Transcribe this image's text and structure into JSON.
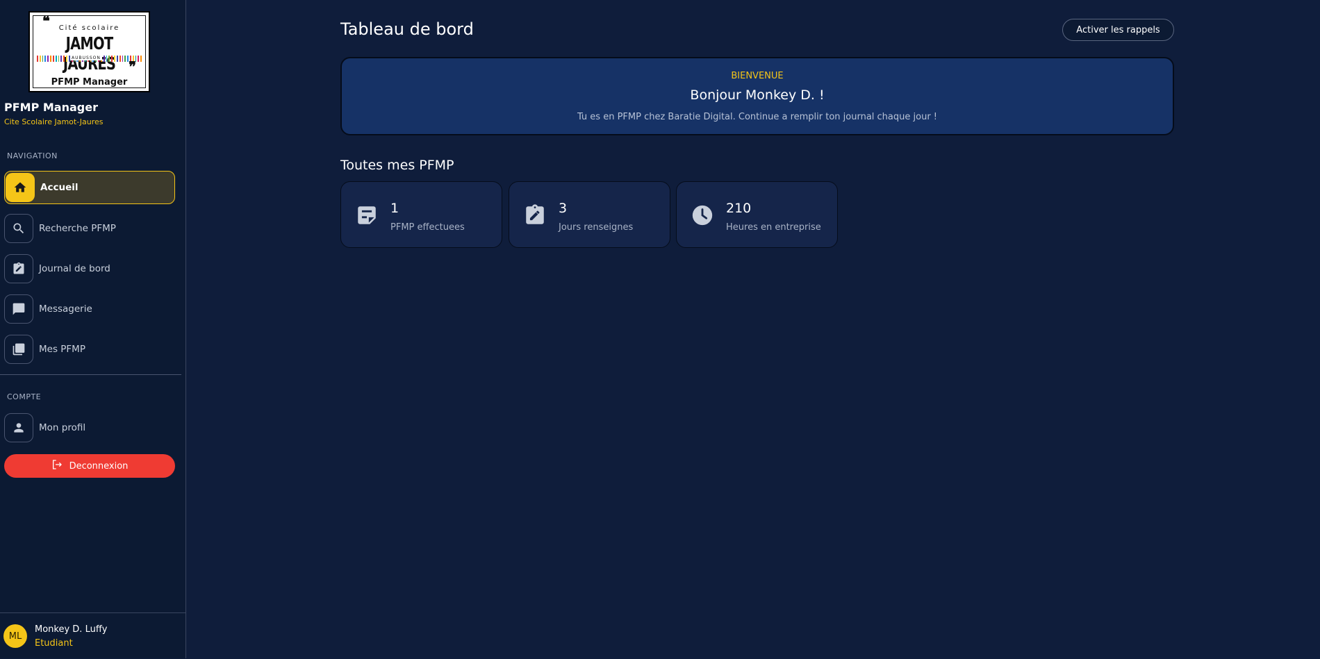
{
  "sidebar": {
    "logo": {
      "line1": "Cité scolaire",
      "line2": "JAMOT JAURES",
      "line3": "AUBUSSON",
      "line4": "PFMP Manager"
    },
    "brand_title": "PFMP Manager",
    "brand_subtitle": "Cite Scolaire Jamot-Jaures",
    "nav_section": "NAVIGATION",
    "nav_items": [
      {
        "label": "Accueil",
        "icon": "home-icon",
        "active": true
      },
      {
        "label": "Recherche PFMP",
        "icon": "search-icon",
        "active": false
      },
      {
        "label": "Journal de bord",
        "icon": "clipboard-edit-icon",
        "active": false
      },
      {
        "label": "Messagerie",
        "icon": "chat-icon",
        "active": false
      },
      {
        "label": "Mes PFMP",
        "icon": "folders-icon",
        "active": false
      }
    ],
    "account_section": "COMPTE",
    "account_items": [
      {
        "label": "Mon profil",
        "icon": "person-icon"
      }
    ],
    "logout_label": "Deconnexion",
    "user": {
      "initials": "ML",
      "name": "Monkey D. Luffy",
      "role": "Etudiant"
    }
  },
  "main": {
    "page_title": "Tableau de bord",
    "reminder_button": "Activer les rappels",
    "welcome": {
      "kicker": "BIENVENUE",
      "title": "Bonjour Monkey D. !",
      "text": "Tu es en PFMP chez Baratie Digital. Continue a remplir ton journal chaque jour !"
    },
    "section_title": "Toutes mes PFMP",
    "stats": [
      {
        "value": "1",
        "label": "PFMP effectuees",
        "icon": "document-icon"
      },
      {
        "value": "3",
        "label": "Jours renseignes",
        "icon": "clipboard-edit-icon"
      },
      {
        "value": "210",
        "label": "Heures en entreprise",
        "icon": "clock-icon"
      }
    ]
  },
  "colors": {
    "background": "#0f1d3b",
    "sidebar": "#0c1a33",
    "accent": "#f5c518",
    "danger": "#ef3b33",
    "welcome_card": "#163266"
  }
}
